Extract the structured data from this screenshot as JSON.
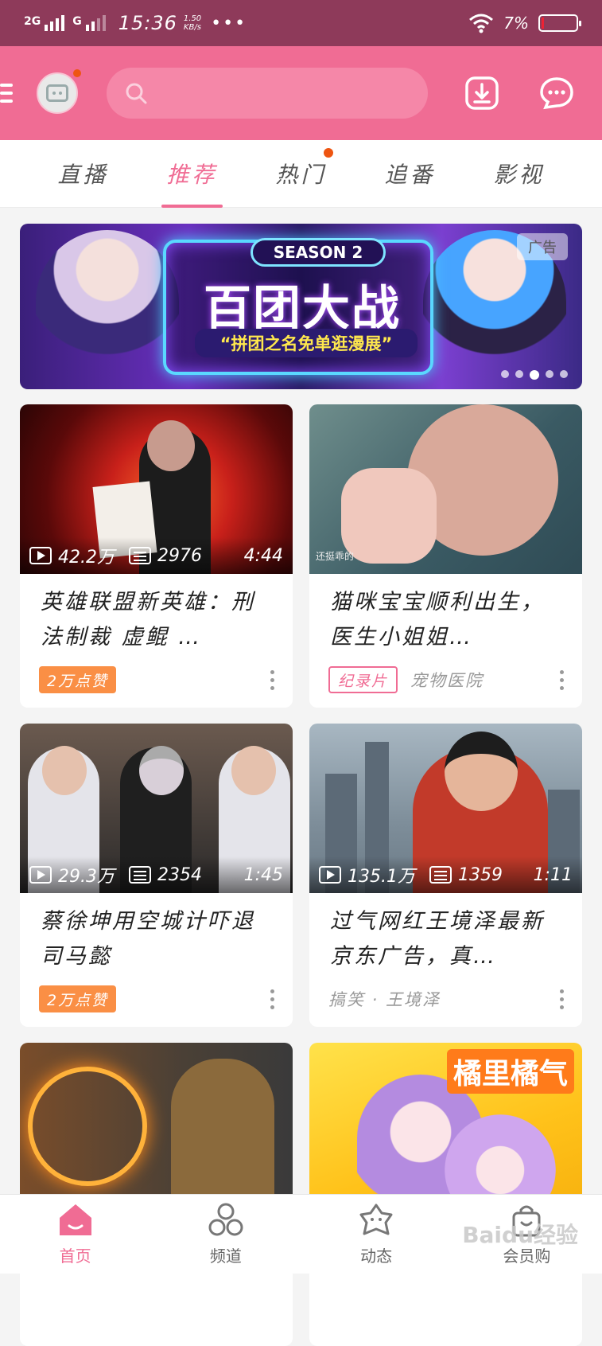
{
  "status_bar": {
    "signal1": "2G",
    "signal2": "G",
    "time": "15:36",
    "speed_value": "1.50",
    "speed_unit": "KB/s",
    "dots": "•••",
    "battery": "7%"
  },
  "tabs": [
    {
      "label": "直播",
      "active": false
    },
    {
      "label": "推荐",
      "active": true
    },
    {
      "label": "热门",
      "active": false,
      "dot": true
    },
    {
      "label": "追番",
      "active": false
    },
    {
      "label": "影视",
      "active": false
    }
  ],
  "banner": {
    "season": "SEASON 2",
    "title": "百团大战",
    "subtitle": "“拼团之名免单逛漫展”",
    "ad_label": "广告"
  },
  "cards": [
    {
      "views": "42.2万",
      "danmaku": "2976",
      "duration": "4:44",
      "title": "英雄联盟新英雄：刑法制裁 虚鲲 …",
      "badge": "2万点赞",
      "badge_style": "orange",
      "tag": ""
    },
    {
      "views": "",
      "danmaku": "",
      "duration": "",
      "caption": "还挺乖的",
      "title": "猫咪宝宝顺利出生，医生小姐姐…",
      "badge": "纪录片",
      "badge_style": "outline",
      "tag": "宠物医院"
    },
    {
      "views": "29.3万",
      "danmaku": "2354",
      "duration": "1:45",
      "title": "蔡徐坤用空城计吓退司马懿",
      "badge": "2万点赞",
      "badge_style": "orange",
      "tag": ""
    },
    {
      "views": "135.1万",
      "danmaku": "1359",
      "duration": "1:11",
      "title": "过气网红王境泽最新京东广告，真…",
      "badge": "",
      "badge_style": "",
      "tag": "搞笑 · 王境泽"
    },
    {
      "views": "",
      "danmaku": "",
      "duration": "",
      "title": "",
      "badge": "",
      "badge_style": "",
      "tag": ""
    },
    {
      "views": "",
      "danmaku": "",
      "duration": "",
      "title": "",
      "badge": "",
      "badge_style": "",
      "tag": "",
      "thumb_word": "橘里橘气"
    }
  ],
  "bottom_nav": [
    {
      "label": "首页",
      "icon": "home-icon",
      "active": true
    },
    {
      "label": "频道",
      "icon": "channels-icon",
      "active": false
    },
    {
      "label": "动态",
      "icon": "dynamic-icon",
      "active": false
    },
    {
      "label": "会员购",
      "icon": "shopping-bag-icon",
      "active": false
    }
  ],
  "watermark": "Baidu经验",
  "colors": {
    "brand_pink": "#f06c94",
    "status_bar": "#8e3a5a",
    "badge_orange": "#fa8f45"
  }
}
